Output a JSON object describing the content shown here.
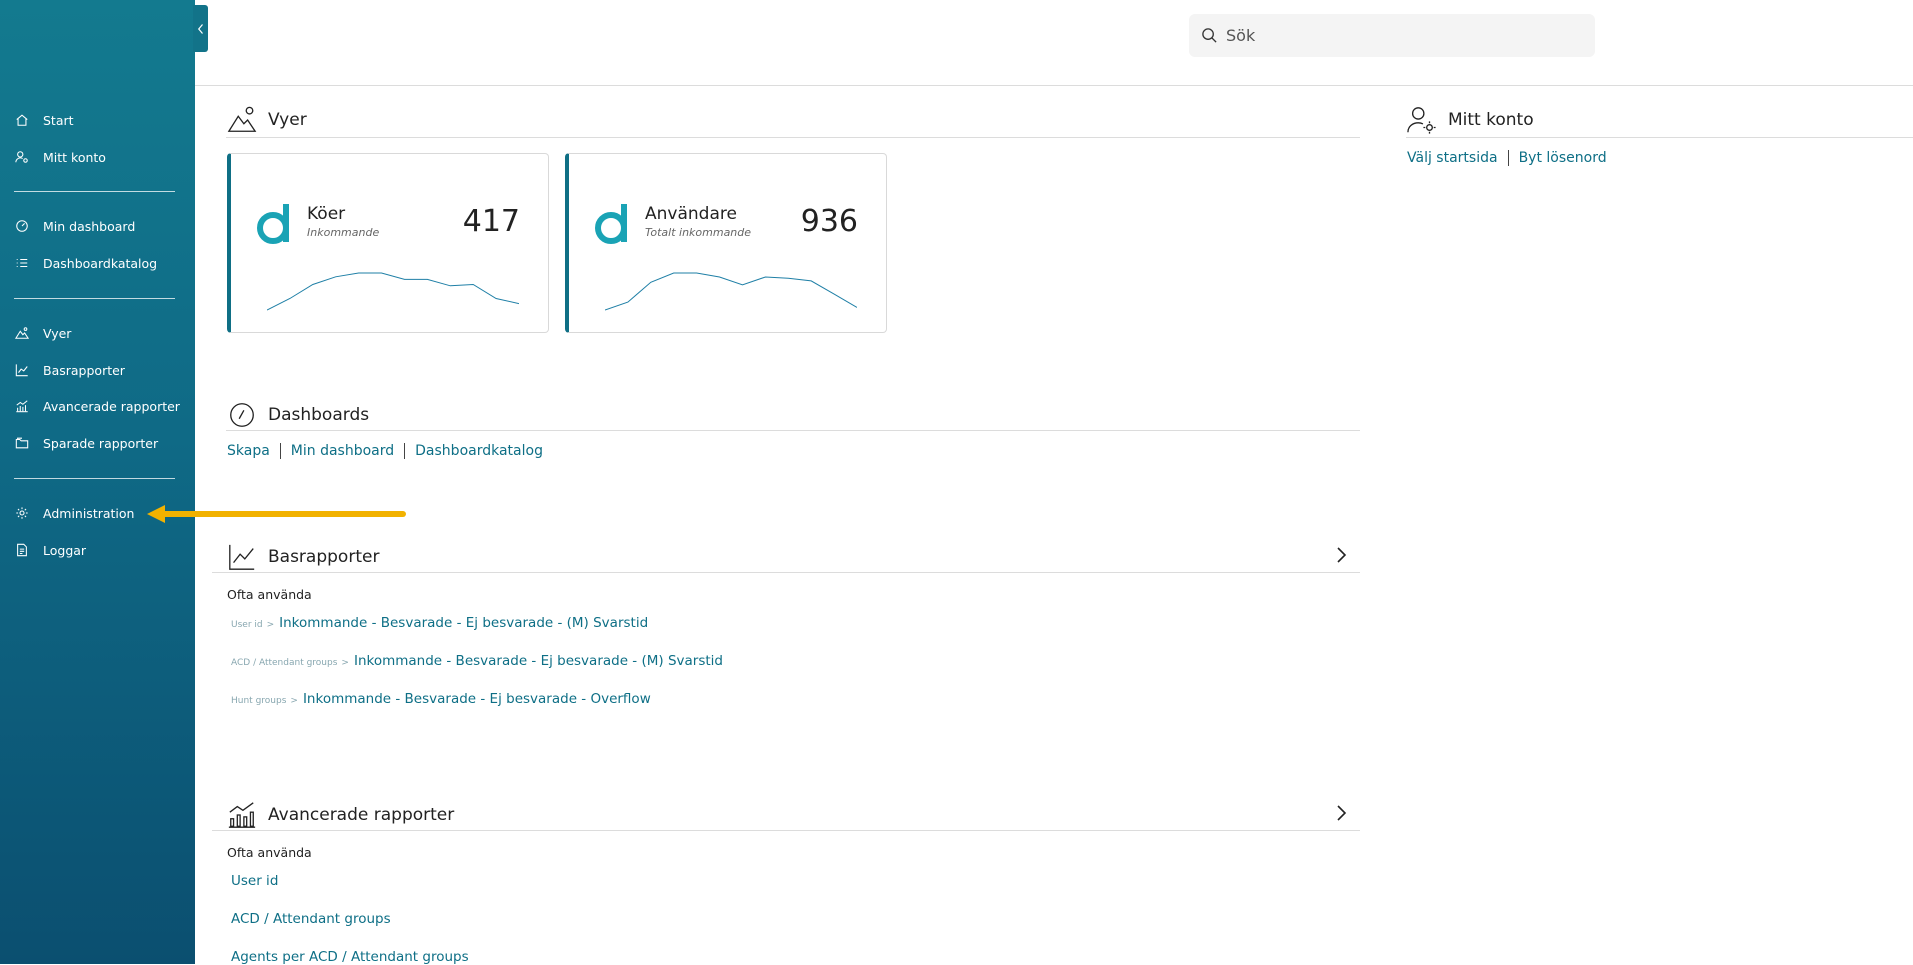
{
  "sidebar": {
    "items": [
      {
        "label": "Start",
        "icon": "home-icon"
      },
      {
        "label": "Mitt konto",
        "icon": "user-cog-icon"
      },
      {
        "label": "Min dashboard",
        "icon": "gauge-icon"
      },
      {
        "label": "Dashboardkatalog",
        "icon": "list-icon"
      },
      {
        "label": "Vyer",
        "icon": "mountain-icon"
      },
      {
        "label": "Basrapporter",
        "icon": "line-chart-icon"
      },
      {
        "label": "Avancerade rapporter",
        "icon": "bar-line-chart-icon"
      },
      {
        "label": "Sparade rapporter",
        "icon": "folder-icon"
      },
      {
        "label": "Administration",
        "icon": "gear-icon"
      },
      {
        "label": "Loggar",
        "icon": "document-icon"
      }
    ]
  },
  "search": {
    "placeholder": "Sök"
  },
  "vyer": {
    "title": "Vyer",
    "cards": [
      {
        "title": "Köer",
        "subtitle": "Inkommande",
        "value": "417",
        "trend": [
          0,
          18,
          40,
          52,
          58,
          58,
          48,
          48,
          38,
          40,
          18,
          10
        ]
      },
      {
        "title": "Användare",
        "subtitle": "Totalt inkommande",
        "value": "936",
        "trend": [
          0,
          12,
          42,
          56,
          56,
          50,
          38,
          50,
          48,
          44,
          24,
          4
        ]
      }
    ]
  },
  "account": {
    "title": "Mitt konto",
    "links": [
      "Välj startsida",
      "Byt lösenord"
    ]
  },
  "dashboards": {
    "title": "Dashboards",
    "links": [
      "Skapa",
      "Min dashboard",
      "Dashboardkatalog"
    ]
  },
  "basrapporter": {
    "title": "Basrapporter",
    "subhead": "Ofta använda",
    "rows": [
      {
        "crumb": "User id",
        "link": "Inkommande - Besvarade - Ej besvarade - (M) Svarstid"
      },
      {
        "crumb": "ACD / Attendant groups",
        "link": "Inkommande - Besvarade - Ej besvarade - (M) Svarstid"
      },
      {
        "crumb": "Hunt groups",
        "link": "Inkommande - Besvarade - Ej besvarade - Overflow"
      }
    ]
  },
  "avancerade": {
    "title": "Avancerade rapporter",
    "subhead": "Ofta använda",
    "links": [
      "User id",
      "ACD / Attendant groups",
      "Agents per ACD / Attendant groups"
    ]
  },
  "colors": {
    "brand": "#0f6f85",
    "link": "#0e6f86",
    "annotation": "#f2b200"
  }
}
